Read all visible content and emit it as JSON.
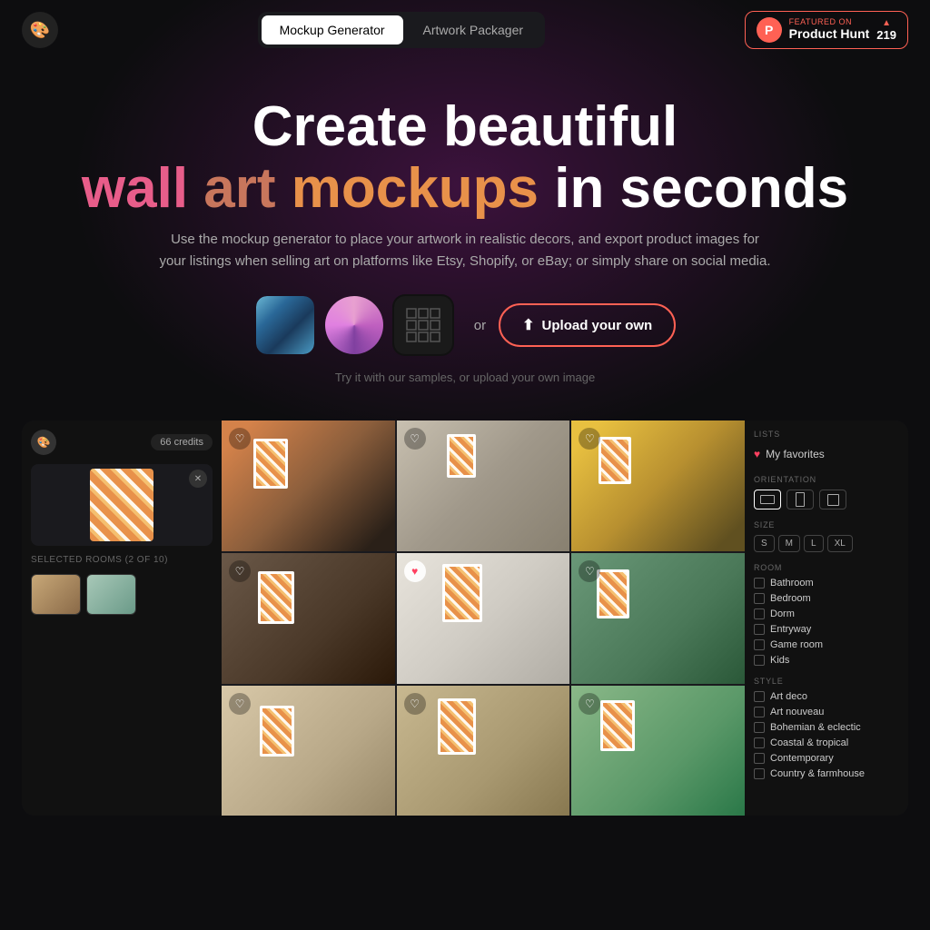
{
  "nav": {
    "logo_emoji": "🎨",
    "tab_mockup": "Mockup Generator",
    "tab_artwork": "Artwork Packager",
    "active_tab": "mockup",
    "ph_featured": "FEATURED ON",
    "ph_name": "Product Hunt",
    "ph_count": "219"
  },
  "hero": {
    "line1": "Create beautiful",
    "word1": "wall",
    "word2": "art",
    "word3": "mockups",
    "word4": "in seconds",
    "subtitle": "Use the mockup generator to place your artwork in realistic decors, and export product images for your listings when selling art on platforms like Etsy, Shopify, or eBay; or simply share on social media.",
    "upload_label": "Upload your own",
    "try_text": "Try it with our samples, or upload your own image"
  },
  "app": {
    "credits": "66 credits",
    "selected_rooms_label": "SELECTED ROOMS (2 OF 10)",
    "filters": {
      "lists_label": "LISTS",
      "my_favorites": "My favorites",
      "orientation_label": "ORIENTATION",
      "size_label": "SIZE",
      "sizes": [
        "S",
        "M",
        "L",
        "XL"
      ],
      "room_label": "ROOM",
      "rooms": [
        "Bathroom",
        "Bedroom",
        "Dorm",
        "Entryway",
        "Game room",
        "Kids"
      ],
      "style_label": "STYLE",
      "styles": [
        "Art deco",
        "Art nouveau",
        "Bohemian & eclectic",
        "Coastal & tropical",
        "Contemporary",
        "Country & farmhouse"
      ]
    }
  }
}
